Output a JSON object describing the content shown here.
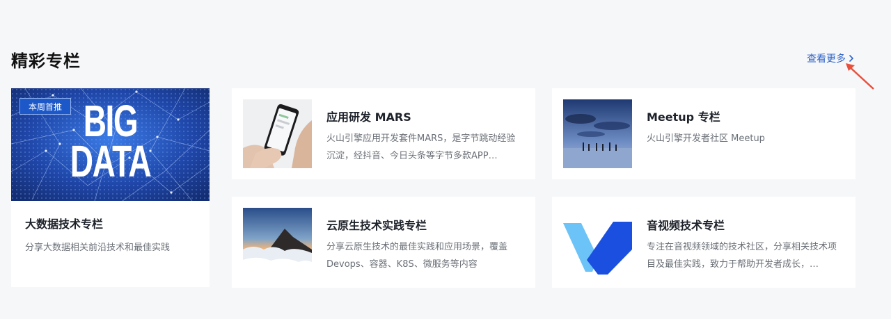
{
  "section": {
    "title": "精彩专栏",
    "more_label": "查看更多",
    "more_icon": "chevron-right-icon"
  },
  "featured": {
    "badge": "本周首推",
    "banner_text": [
      "BIG",
      "DATA"
    ],
    "title": "大数据技术专栏",
    "desc": "分享大数据相关前沿技术和最佳实践"
  },
  "cards": [
    {
      "title": "应用研发 MARS",
      "desc": "火山引擎应用开发套件MARS，是字节跳动经验沉淀，经抖音、今日头条等字节多款APP…",
      "image": "hand-holding-phone"
    },
    {
      "title": "Meetup 专栏",
      "desc": "火山引擎开发者社区 Meetup",
      "image": "people-on-beach-at-dusk"
    },
    {
      "title": "云原生技术实践专栏",
      "desc": "分享云原生技术的最佳实践和应用场景，覆盖Devops、容器、K8S、微服务等内容",
      "image": "mountain-above-clouds"
    },
    {
      "title": "音视频技术专栏",
      "desc": "专注在音视频领域的技术社区，分享相关技术项目及最佳实践，致力于帮助开发者成长，…",
      "image": "v-logo"
    }
  ],
  "colors": {
    "link": "#2f64c8",
    "badge": "#1d58c9",
    "annotation": "#e8503c"
  }
}
